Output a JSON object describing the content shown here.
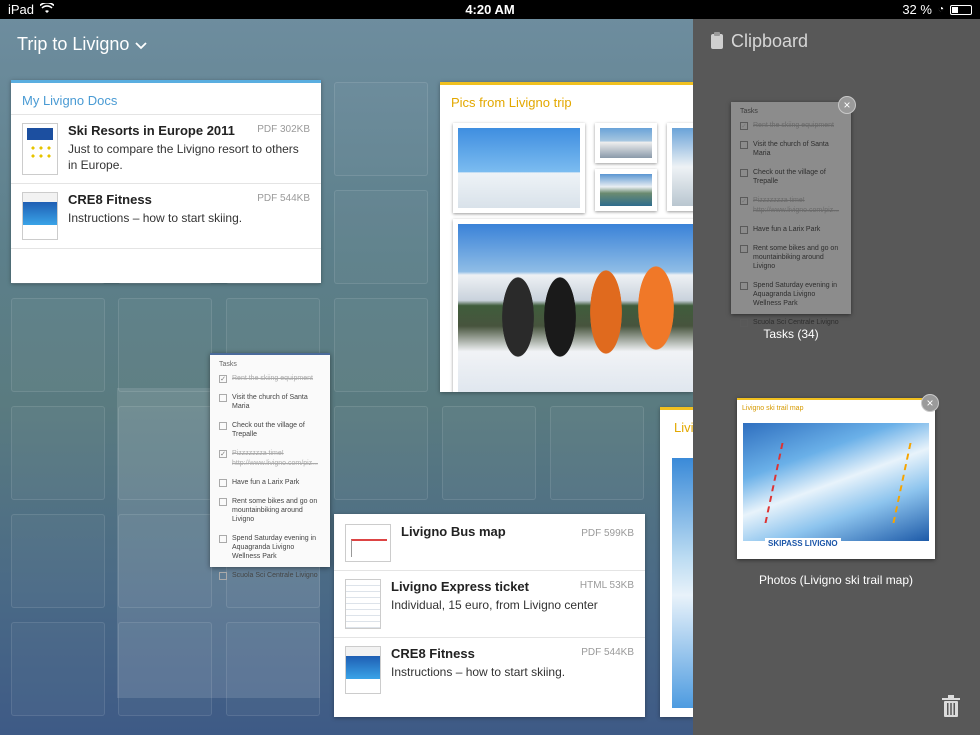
{
  "status_bar": {
    "device": "iPad",
    "time": "4:20 AM",
    "battery": "32 %",
    "battery_level": 0.32
  },
  "space": {
    "title": "Trip to Livigno"
  },
  "docs_card": {
    "title": "My Livigno Docs",
    "items": [
      {
        "title": "Ski Resorts in Europe 2011",
        "meta": "PDF 302KB",
        "desc": "Just to compare the Livigno resort to others in Europe."
      },
      {
        "title": "CRE8 Fitness",
        "meta": "PDF 544KB",
        "desc": "Instructions – how to start skiing."
      }
    ]
  },
  "pics_card": {
    "title": "Pics from Livigno trip"
  },
  "partial_card": {
    "title": "Livi"
  },
  "bottom_card": {
    "items": [
      {
        "title": "Livigno Bus map",
        "meta": "PDF 599KB",
        "desc": ""
      },
      {
        "title": "Livigno Express ticket",
        "meta": "HTML 53KB",
        "desc": "Individual, 15 euro, from Livigno center"
      },
      {
        "title": "CRE8 Fitness",
        "meta": "PDF 544KB",
        "desc": "Instructions – how to start skiing."
      }
    ]
  },
  "tasks": {
    "title": "Tasks",
    "items": [
      {
        "text": "Rent the skiing equipment",
        "done": true
      },
      {
        "text": "Visit the church of Santa Maria",
        "done": false
      },
      {
        "text": "Check out the village of Trepalle",
        "done": false
      },
      {
        "text": "Pizzzzzzza time! http://www.livigno.com/piz...",
        "done": true
      },
      {
        "text": "Have fun a Larix Park",
        "done": false
      },
      {
        "text": "Rent some bikes and go on mountainbiking around Livigno",
        "done": false
      },
      {
        "text": "Spend Saturday evening in Aquagranda Livigno Wellness Park",
        "done": false
      },
      {
        "text": "Scuola Sci Centrale Livigno",
        "done": false
      }
    ]
  },
  "clipboard": {
    "title": "Clipboard",
    "tasks_caption": "Tasks (34)",
    "map_title": "Livigno ski trail map",
    "map_caption": "Photos (Livigno ski trail map)",
    "map_logo": "SKIPASS LIVIGNO"
  }
}
